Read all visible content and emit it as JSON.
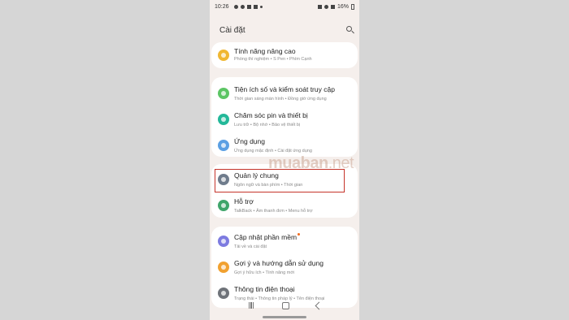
{
  "status_bar": {
    "time": "10:26",
    "left_icons": [
      "google-icon",
      "location-icon",
      "gallery-icon",
      "notification-icon",
      "dot-icon"
    ],
    "right_icons": [
      "mute-icon",
      "wifi-icon",
      "signal-icon"
    ],
    "battery": "16%"
  },
  "header": {
    "title": "Cài đặt",
    "search_icon": "search-icon"
  },
  "groups": [
    {
      "items": [
        {
          "label": "Tính năng nâng cao",
          "subtitle": "Phòng thí nghiệm  •  S Pen  •  Phím Cạnh",
          "icon": "advanced-features-icon",
          "color": "#f0b732",
          "badge": false
        }
      ]
    },
    {
      "items": [
        {
          "label": "Tiện ích số và kiểm soát truy cập",
          "subtitle": "Thời gian sáng màn hình  •  Đồng giờ ứng dụng",
          "icon": "digital-wellbeing-icon",
          "color": "#5cc564",
          "badge": false
        },
        {
          "label": "Chăm sóc pin và thiết bị",
          "subtitle": "Lưu trữ  •  Bộ nhớ  •  Bảo vệ thiết bị",
          "icon": "device-care-icon",
          "color": "#23b899",
          "badge": false
        },
        {
          "label": "Ứng dụng",
          "subtitle": "Ứng dụng mặc định  •  Cài đặt ứng dụng",
          "icon": "apps-icon",
          "color": "#5b9fe3",
          "badge": false
        }
      ]
    },
    {
      "items": [
        {
          "label": "Quản lý chung",
          "subtitle": "Ngôn ngữ và bàn phím  •  Thời gian",
          "icon": "general-management-icon",
          "color": "#6f7c8c",
          "badge": false
        },
        {
          "label": "Hỗ trợ",
          "subtitle": "TalkBack  •  Âm thanh đơn  •  Menu hỗ trợ",
          "icon": "accessibility-icon",
          "color": "#3fa56a",
          "badge": false
        }
      ]
    },
    {
      "items": [
        {
          "label": "Cập nhật phần mềm",
          "subtitle": "Tải về và cài đặt",
          "icon": "software-update-icon",
          "color": "#7d7be0",
          "badge": true
        },
        {
          "label": "Gợi ý và hướng dẫn sử dụng",
          "subtitle": "Gợi ý hữu ích  •  Tính năng mới",
          "icon": "tips-icon",
          "color": "#f1a130",
          "badge": false
        },
        {
          "label": "Thông tin điện thoại",
          "subtitle": "Trạng thái  •  Thông tin pháp lý  •  Tên điện thoại",
          "icon": "about-phone-icon",
          "color": "#6f7379",
          "badge": false
        }
      ]
    }
  ],
  "watermark": {
    "brand": "muaban",
    "tld": ".net"
  },
  "nav_bar": [
    "recent-apps-icon",
    "home-icon",
    "back-icon"
  ]
}
